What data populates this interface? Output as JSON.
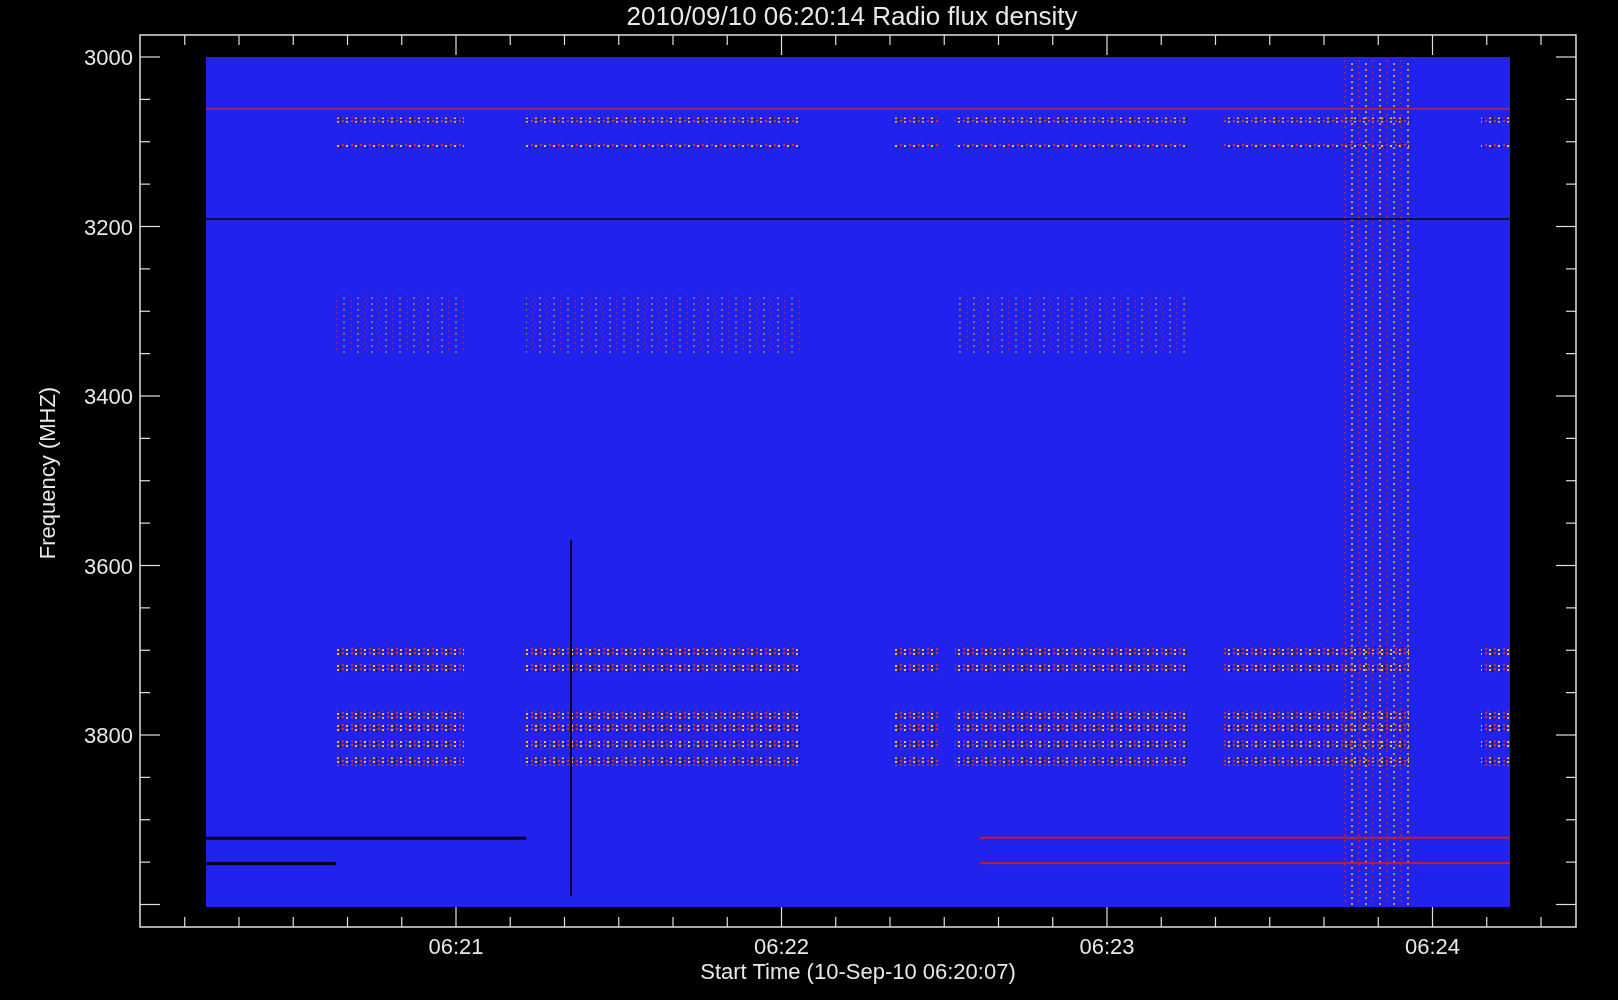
{
  "title": "2010/09/10 06:20:14 Radio flux density",
  "y_axis": {
    "label": "Frequency (MHZ)",
    "tick_labels": [
      "3000",
      "3200",
      "3400",
      "3600",
      "3800"
    ]
  },
  "x_axis": {
    "label": "Start Time (10-Sep-10 06:20:07)",
    "tick_labels": [
      "06:21",
      "06:22",
      "06:23",
      "06:24"
    ]
  }
}
